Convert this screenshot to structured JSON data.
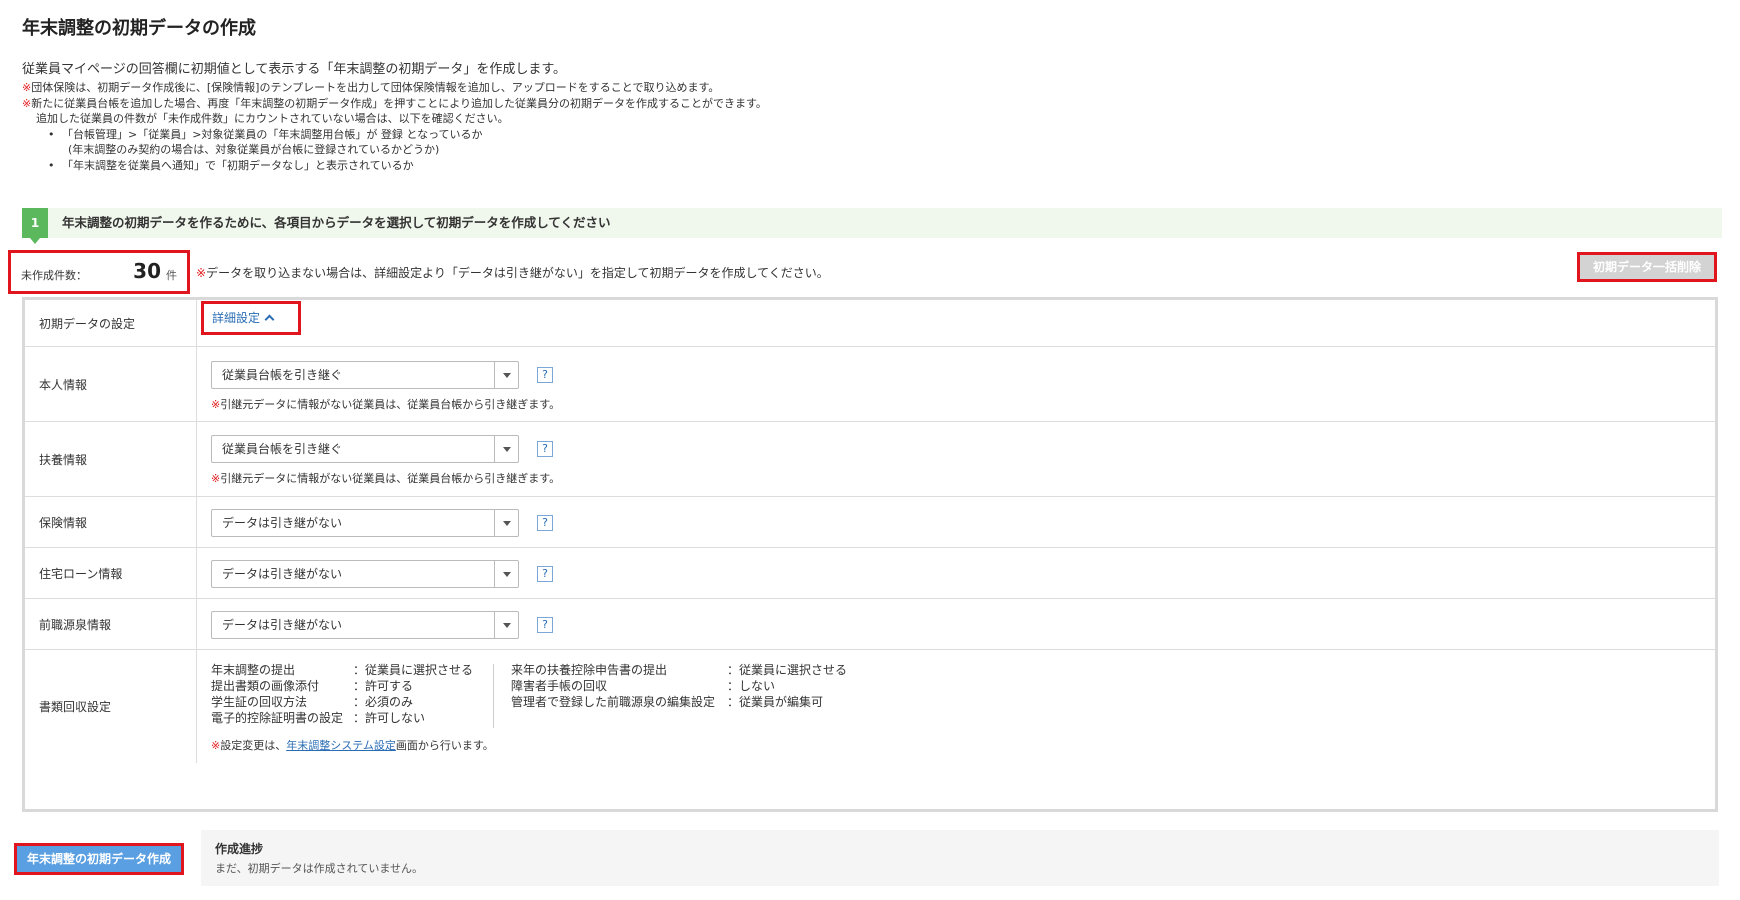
{
  "page": {
    "title": "年末調整の初期データの作成",
    "intro": "従業員マイページの回答欄に初期値として表示する「年末調整の初期データ」を作成します。"
  },
  "notes": {
    "mark": "※",
    "line1": "団体保険は、初期データ作成後に、[保険情報]のテンプレートを出力して団体保険情報を追加し、アップロードをすることで取り込めます。",
    "line2": "新たに従業員台帳を追加した場合、再度「年末調整の初期データ作成」を押すことにより追加した従業員分の初期データを作成することができます。",
    "line3": "追加した従業員の件数が「未作成件数」にカウントされていない場合は、以下を確認ください。",
    "bullet1": "「台帳管理」>「従業員」>対象従業員の「年末調整用台帳」が 登録 となっているか",
    "bullet1_sub": "(年末調整のみ契約の場合は、対象従業員が台帳に登録されているかどうか)",
    "bullet2": "「年末調整を従業員へ通知」で「初期データなし」と表示されているか"
  },
  "step": {
    "number": "1",
    "text": "年末調整の初期データを作るために、各項目からデータを選択して初期データを作成してください"
  },
  "count": {
    "label": "未作成件数：",
    "value": "30",
    "unit": "件",
    "note": "データを取り込まない場合は、詳細設定より「データは引き継がない」を指定して初期データを作成してください。"
  },
  "delete_button": "初期データ一括削除",
  "settings": {
    "label": "初期データの設定",
    "toggle": "詳細設定"
  },
  "rows": [
    {
      "label": "本人情報",
      "select": "従業員台帳を引き継ぐ",
      "note": "引継元データに情報がない従業員は、従業員台帳から引き継ぎます。"
    },
    {
      "label": "扶養情報",
      "select": "従業員台帳を引き継ぐ",
      "note": "引継元データに情報がない従業員は、従業員台帳から引き継ぎます。"
    },
    {
      "label": "保険情報",
      "select": "データは引き継がない"
    },
    {
      "label": "住宅ローン情報",
      "select": "データは引き継がない"
    },
    {
      "label": "前職源泉情報",
      "select": "データは引き継がない"
    }
  ],
  "help_mark": "?",
  "documents": {
    "label": "書類回収設定",
    "left": [
      {
        "k": "年末調整の提出",
        "v": "：従業員に選択させる"
      },
      {
        "k": "提出書類の画像添付",
        "v": "：許可する"
      },
      {
        "k": "学生証の回収方法",
        "v": "：必須のみ"
      },
      {
        "k": "電子的控除証明書の設定",
        "v": "：許可しない"
      }
    ],
    "right": [
      {
        "k": "来年の扶養控除申告書の提出",
        "v": "：従業員に選択させる"
      },
      {
        "k": "障害者手帳の回収",
        "v": "：しない"
      },
      {
        "k": "管理者で登録した前職源泉の編集設定",
        "v": "：従業員が編集可"
      }
    ],
    "note_prefix": "設定変更は、",
    "note_link": "年末調整システム設定",
    "note_suffix": "画面から行います。"
  },
  "create_button": "年末調整の初期データ作成",
  "progress": {
    "title": "作成進捗",
    "text": "まだ、初期データは作成されていません。"
  }
}
